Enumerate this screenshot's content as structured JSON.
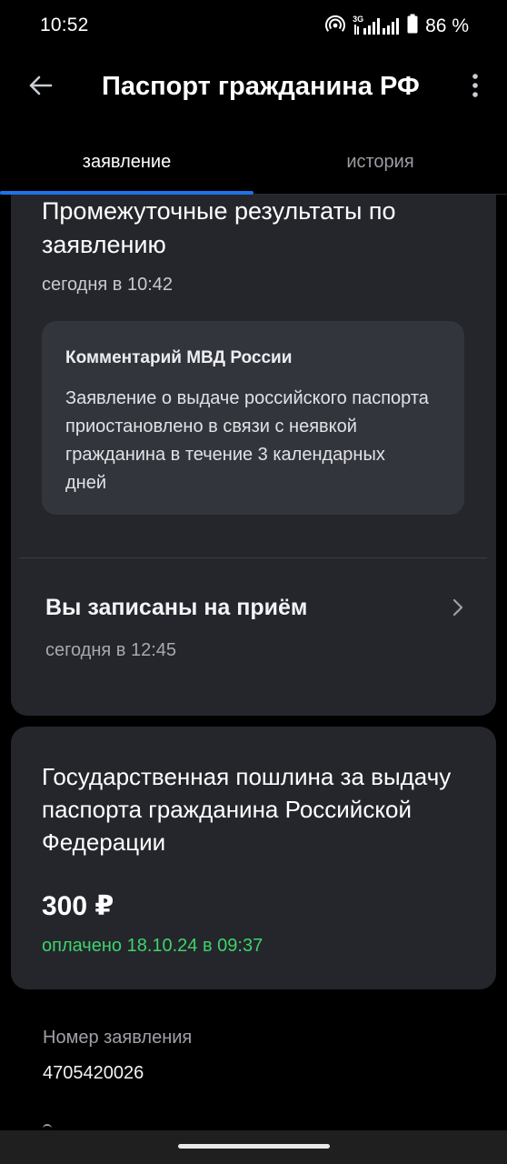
{
  "status_bar": {
    "time": "10:52",
    "network_label": "3G",
    "battery_percent": "86 %"
  },
  "header": {
    "title": "Паспорт гражданина РФ",
    "back_icon": "arrow-left-icon",
    "menu_icon": "more-vertical-icon"
  },
  "tabs": [
    {
      "label": "заявление",
      "active": true
    },
    {
      "label": "история",
      "active": false
    }
  ],
  "intermediate_card": {
    "title": "Промежуточные результаты по заявлению",
    "time": "сегодня в 10:42",
    "comment": {
      "title": "Комментарий МВД России",
      "text": "Заявление о выдаче российского паспорта приостановлено в связи с неявкой гражданина в течение 3 календарных дней"
    },
    "appointment": {
      "title": "Вы записаны на приём",
      "time": "сегодня в 12:45"
    }
  },
  "fee_card": {
    "title": "Государственная пошлина за выдачу паспорта гражданина Российской Федерации",
    "amount": "300 ₽",
    "status": "оплачено 18.10.24 в 09:37"
  },
  "details": {
    "application_number_label": "Номер заявления",
    "application_number": "4705420026"
  },
  "colors": {
    "background": "#000000",
    "card": "#24262c",
    "comment_box": "#33353c",
    "accent": "#1d73e8",
    "paid_green": "#3ed36b"
  }
}
